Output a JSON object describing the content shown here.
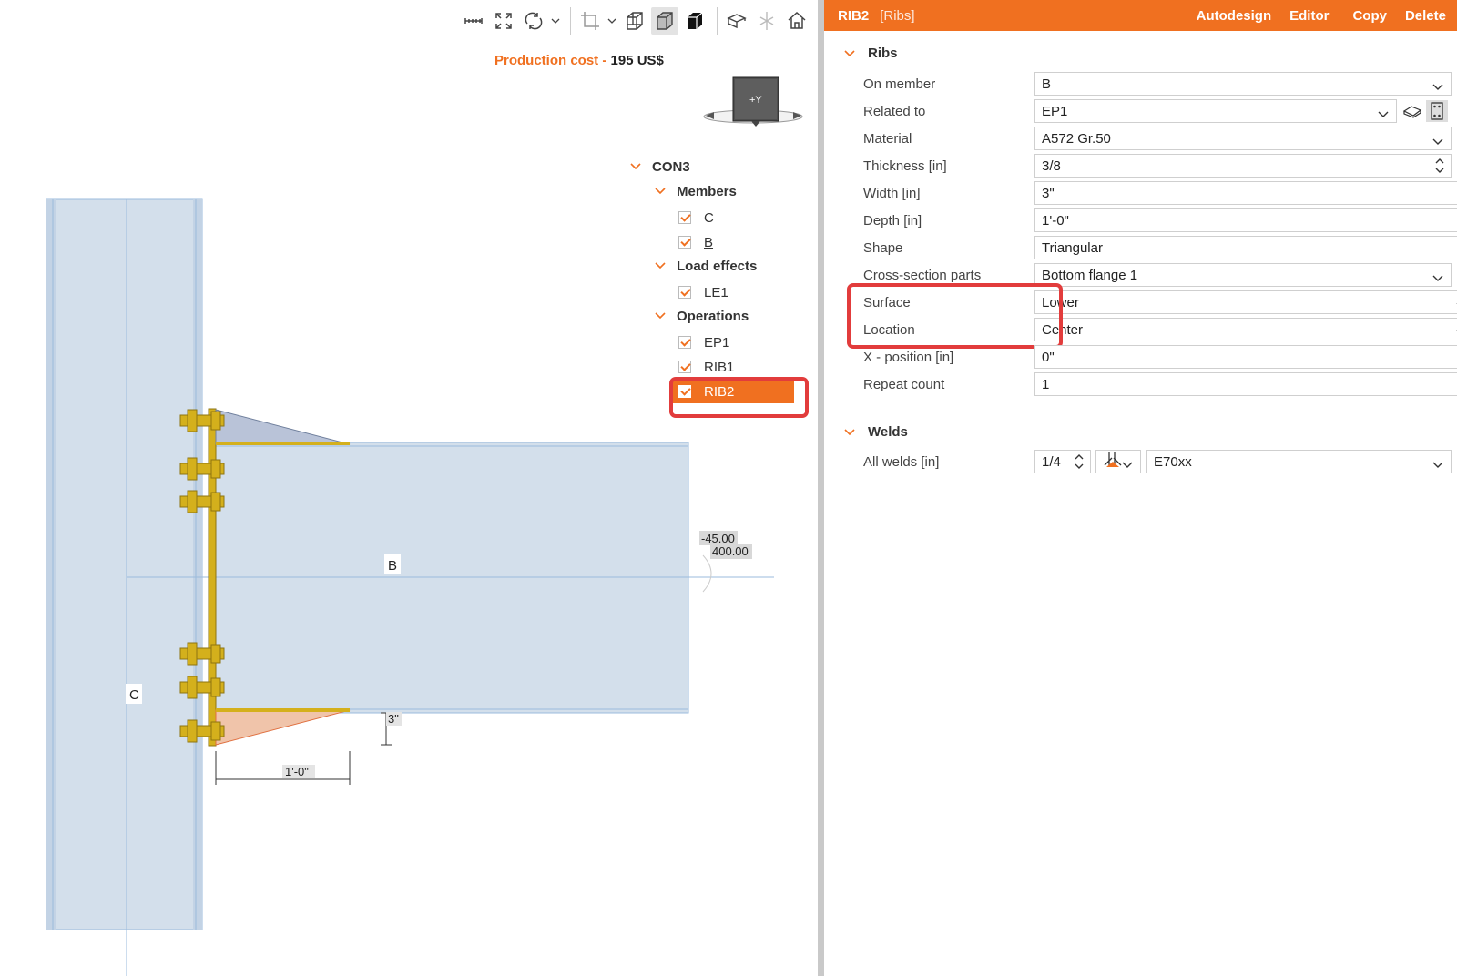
{
  "toolbar": {
    "icons": [
      "measure-icon",
      "fit-view-icon",
      "rotate-icon",
      "crop-icon",
      "wireframe-cube-icon",
      "shaded-cube-icon",
      "solid-cube-icon",
      "section-icon",
      "clip-icon",
      "home-icon"
    ]
  },
  "production_cost": {
    "label": "Production cost",
    "separator": " - ",
    "value": "195 US$"
  },
  "navcube": {
    "face_label": "+Y"
  },
  "tree": {
    "root": "CON3",
    "groups": [
      {
        "label": "Members",
        "items": [
          "C",
          "B"
        ]
      },
      {
        "label": "Load effects",
        "items": [
          "LE1"
        ]
      },
      {
        "label": "Operations",
        "items": [
          "EP1",
          "RIB1",
          "RIB2"
        ]
      }
    ],
    "selected": "RIB2"
  },
  "scene": {
    "member_c_label": "C",
    "member_b_label": "B",
    "angle_label": "-45.00",
    "length_label": "400.00",
    "dim_width": "3\"",
    "dim_depth": "1'-0\""
  },
  "panel": {
    "title": "RIB2",
    "subtitle": "[Ribs]",
    "actions": [
      "Autodesign",
      "Editor",
      "Copy",
      "Delete"
    ],
    "ribs_section": "Ribs",
    "welds_section": "Welds",
    "props": {
      "on_member": {
        "label": "On member",
        "value": "B"
      },
      "related_to": {
        "label": "Related to",
        "value": "EP1"
      },
      "material": {
        "label": "Material",
        "value": "A572 Gr.50"
      },
      "thickness": {
        "label": "Thickness [in]",
        "value": "3/8"
      },
      "width": {
        "label": "Width [in]",
        "value": "3\""
      },
      "depth": {
        "label": "Depth [in]",
        "value": "1'-0\""
      },
      "shape": {
        "label": "Shape",
        "value": "Triangular"
      },
      "cs_parts": {
        "label": "Cross-section parts",
        "value": "Bottom flange 1"
      },
      "surface": {
        "label": "Surface",
        "value": "Lower"
      },
      "location": {
        "label": "Location",
        "value": "Center"
      },
      "x_position": {
        "label": "X - position [in]",
        "value": "0\""
      },
      "repeat_count": {
        "label": "Repeat count",
        "value": "1"
      },
      "all_welds": {
        "label": "All welds [in]",
        "size": "1/4",
        "electrode": "E70xx"
      }
    }
  },
  "colors": {
    "accent": "#f07020",
    "highlight": "#e23c3c",
    "steel": "#d3dfeb",
    "bolt": "#d4b01c"
  }
}
